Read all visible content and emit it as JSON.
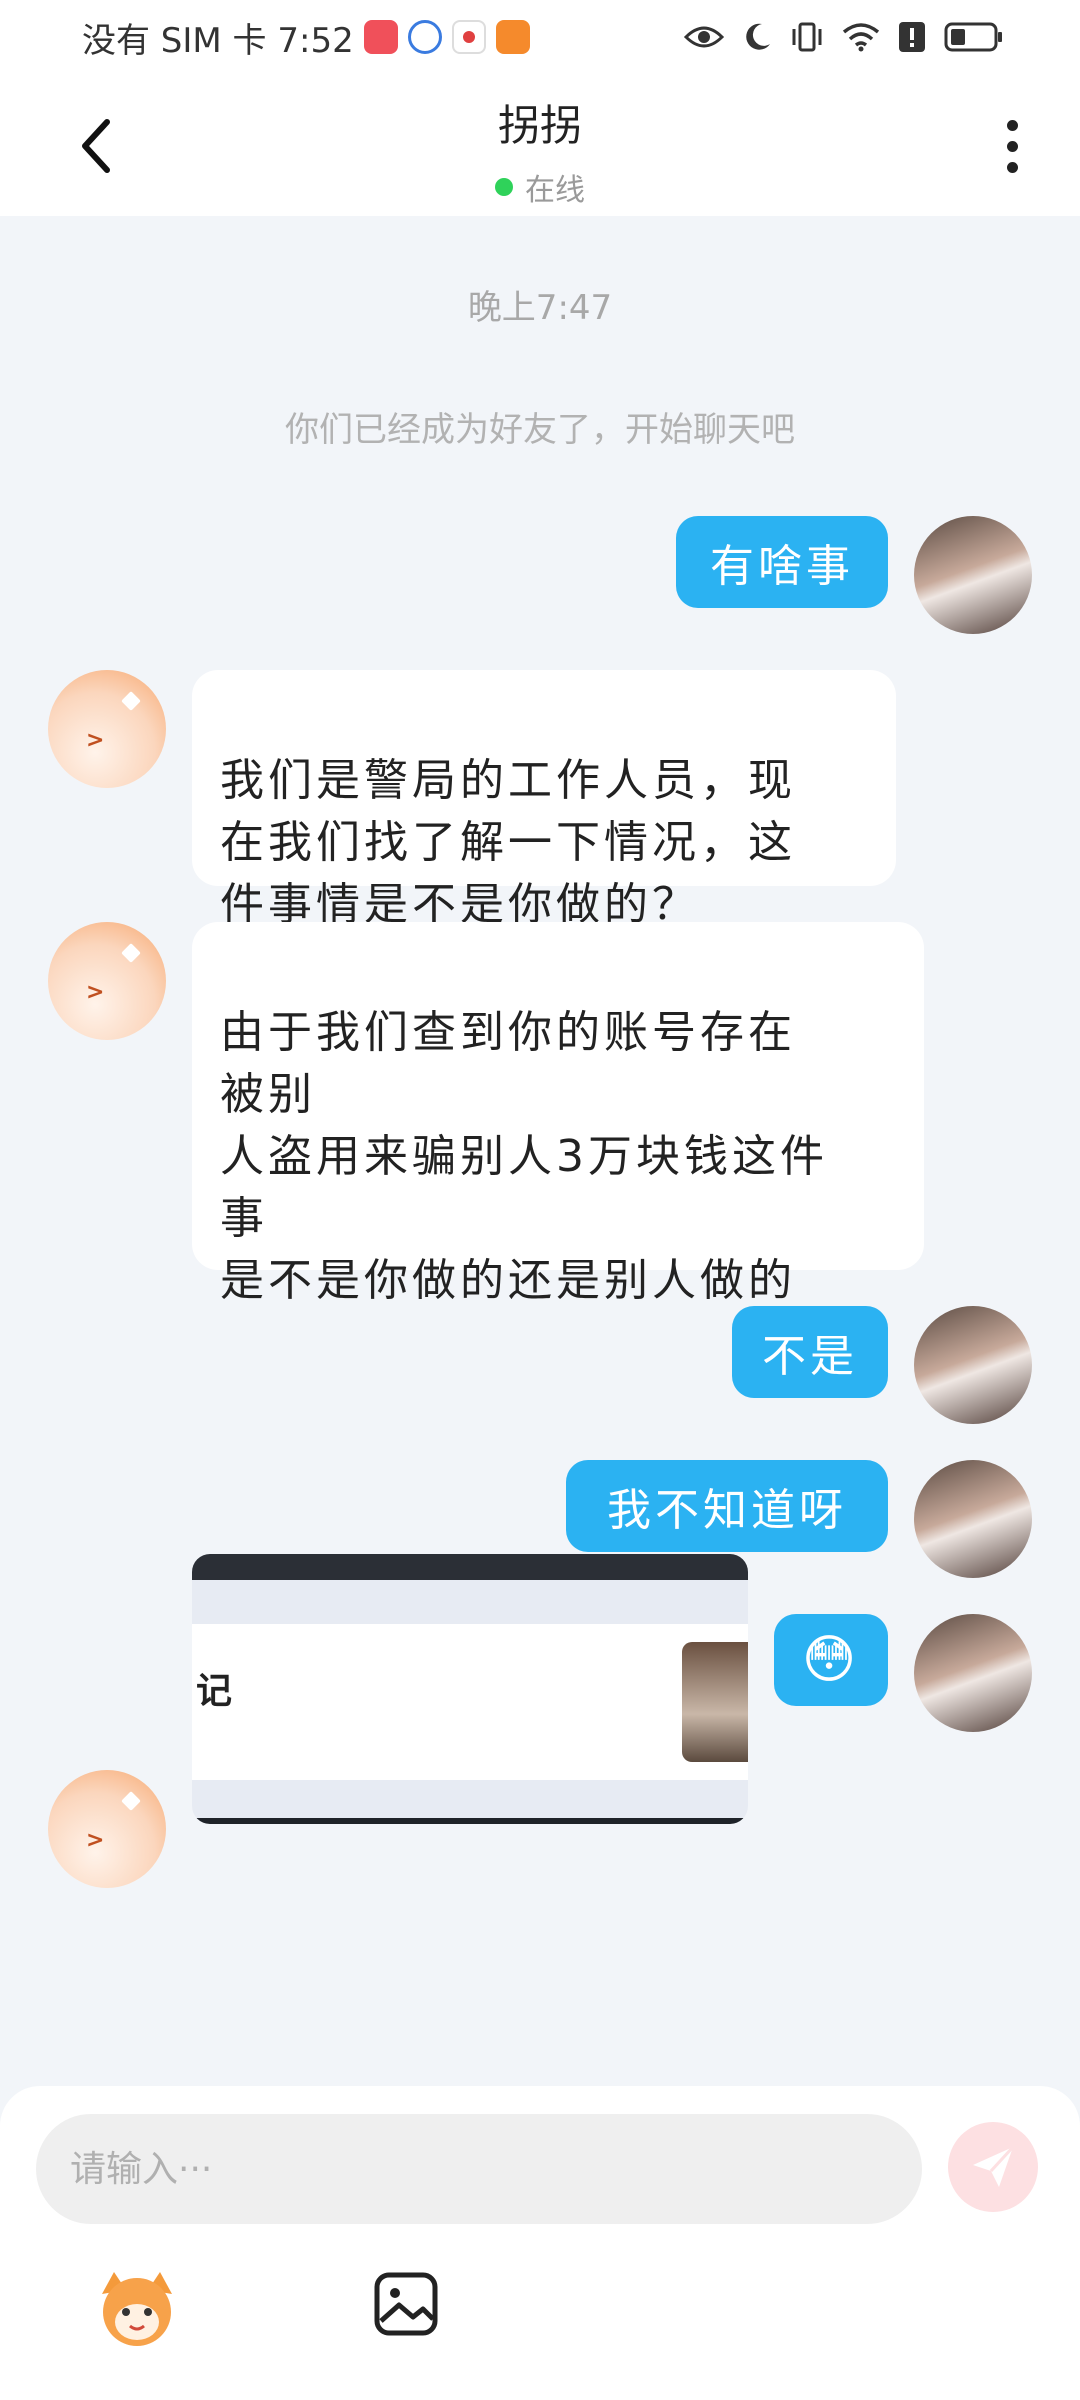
{
  "status_bar": {
    "carrier_time": "没有 SIM 卡 7:52",
    "app_icons": [
      "huawei-app-icon",
      "browser-app-icon",
      "record-app-icon",
      "video-app-icon"
    ],
    "right_icons": [
      "eye-icon",
      "moon-icon",
      "vibrate-icon",
      "wifi-icon",
      "alert-icon",
      "battery-icon"
    ]
  },
  "header": {
    "title": "拐拐",
    "status": "在线",
    "status_color": "#2fd25a"
  },
  "chat": {
    "time_label": "晚上7:47",
    "system_note": "你们已经成为好友了，开始聊天吧",
    "messages": [
      {
        "side": "me",
        "text": "有啥事"
      },
      {
        "side": "other",
        "text": "我们是警局的工作人员，现\n在我们找了解一下情况，这\n件事情是不是你做的？"
      },
      {
        "side": "other",
        "text": "由于我们查到你的账号存在\n被别\n人盗用来骗别人3万块钱这件\n事\n是不是你做的还是别人做的"
      },
      {
        "side": "me",
        "text": "不是"
      },
      {
        "side": "me",
        "text": "我不知道呀"
      },
      {
        "side": "me",
        "text": "😳"
      },
      {
        "side": "other",
        "type": "image",
        "image_text": "记"
      }
    ]
  },
  "input": {
    "placeholder": "请输入···",
    "send_icon": "send-icon",
    "tools": [
      "mascot-icon",
      "image-icon"
    ]
  },
  "colors": {
    "my_bubble": "#2bb2f2",
    "other_bubble": "#ffffff",
    "background": "#f2f5f9"
  }
}
